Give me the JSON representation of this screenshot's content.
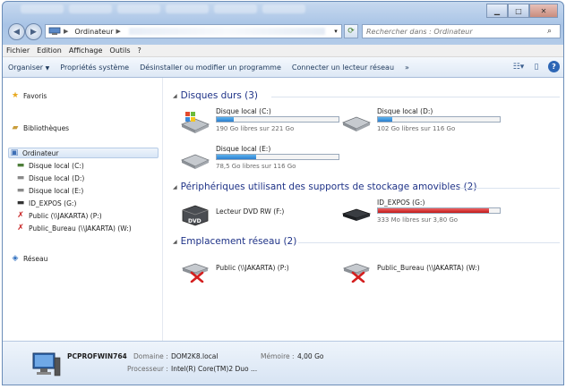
{
  "address": {
    "crumbs": [
      "Ordinateur"
    ]
  },
  "search": {
    "placeholder": "Rechercher dans : Ordinateur"
  },
  "menu": [
    "Fichier",
    "Edition",
    "Affichage",
    "Outils",
    "?"
  ],
  "commands": {
    "organize": "Organiser",
    "properties": "Propriétés système",
    "uninstall": "Désinstaller ou modifier un programme",
    "connect": "Connecter un lecteur réseau",
    "more": "»"
  },
  "nav": {
    "favorites": "Favoris",
    "libraries": "Bibliothèques",
    "computer": "Ordinateur",
    "drives": [
      "Disque local (C:)",
      "Disque local (D:)",
      "Disque local (E:)",
      "ID_EXPOS (G:)",
      "Public (\\\\JAKARTA) (P:)",
      "Public_Bureau (\\\\JAKARTA) (W:)"
    ],
    "network": "Réseau"
  },
  "groups": {
    "hard_disks": "Disques durs (3)",
    "removable": "Périphériques utilisant des supports de stockage amovibles (2)",
    "network": "Emplacement réseau (2)"
  },
  "hard_disks": [
    {
      "name": "Disque local (C:)",
      "free": "190 Go libres sur 221 Go",
      "used_fraction": 0.14
    },
    {
      "name": "Disque local (D:)",
      "free": "102 Go libres sur 116 Go",
      "used_fraction": 0.12
    },
    {
      "name": "Disque local (E:)",
      "free": "78,5 Go libres sur 116 Go",
      "used_fraction": 0.32
    }
  ],
  "removable": [
    {
      "name": "Lecteur DVD RW (F:)"
    },
    {
      "name": "ID_EXPOS (G:)",
      "free": "333 Mo libres sur 3,80 Go",
      "used_fraction": 0.91
    }
  ],
  "network_locations": [
    {
      "name": "Public (\\\\JAKARTA) (P:)"
    },
    {
      "name": "Public_Bureau (\\\\JAKARTA) (W:)"
    }
  ],
  "details": {
    "computer_name": "PCPROFWIN764",
    "domain_label": "Domaine :",
    "domain": "DOM2K8.local",
    "memory_label": "Mémoire :",
    "memory": "4,00 Go",
    "processor_label": "Processeur :",
    "processor": "Intel(R) Core(TM)2 Duo ..."
  },
  "colors": {
    "bar_normal": "#2b7fcf",
    "bar_full": "#c01818",
    "group_title": "#1e3287"
  }
}
